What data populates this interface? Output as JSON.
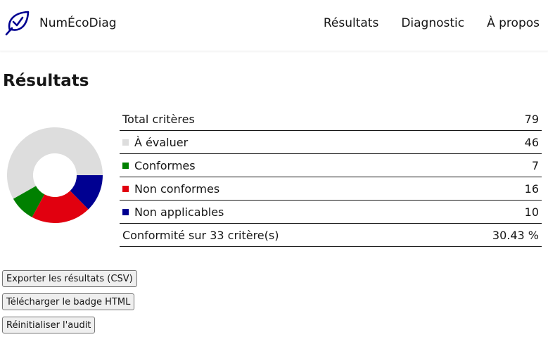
{
  "header": {
    "brand": "NumÉcoDiag",
    "nav": [
      "Résultats",
      "Diagnostic",
      "À propos"
    ]
  },
  "page": {
    "title": "Résultats"
  },
  "stats": {
    "total_label": "Total critères",
    "total_value": "79",
    "rows": [
      {
        "label": "À évaluer",
        "value": "46",
        "color": "#dddddd"
      },
      {
        "label": "Conformes",
        "value": "7",
        "color": "#008000"
      },
      {
        "label": "Non conformes",
        "value": "16",
        "color": "#e1000f"
      },
      {
        "label": "Non applicables",
        "value": "10",
        "color": "#000091"
      }
    ],
    "conformity_label": "Conformité sur 33 critère(s)",
    "conformity_value": "30.43 %"
  },
  "chart_data": {
    "type": "pie",
    "categories": [
      "À évaluer",
      "Conformes",
      "Non conformes",
      "Non applicables"
    ],
    "values": [
      46,
      7,
      16,
      10
    ],
    "colors": [
      "#dddddd",
      "#008000",
      "#e1000f",
      "#000091"
    ]
  },
  "buttons": {
    "export": "Exporter les résultats (CSV)",
    "badge": "Télécharger le badge HTML",
    "reset": "Réinitialiser l'audit"
  },
  "colors": {
    "logo": "#000091",
    "text": "#161616"
  }
}
